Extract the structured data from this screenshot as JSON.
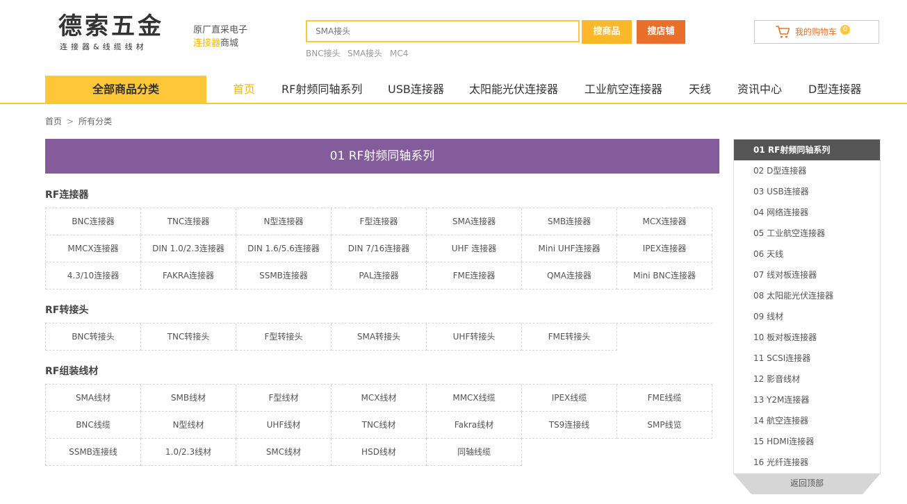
{
  "logo": {
    "main": "德索五金",
    "sub": "连接器&线缆线材"
  },
  "slogan": {
    "line1": "原厂直采电子",
    "line2_highlight": "连接器",
    "line2_rest": "商城"
  },
  "search": {
    "placeholder": "SMA接头",
    "goods_btn": "搜商品",
    "shop_btn": "搜店铺",
    "hot": [
      "BNC接头",
      "SMA接头",
      "MC4"
    ]
  },
  "cart": {
    "label": "我的购物车",
    "count": "0",
    "icon": "cart-icon"
  },
  "nav": {
    "all_categories": "全部商品分类",
    "items": [
      "首页",
      "RF射频同轴系列",
      "USB连接器",
      "太阳能光伏连接器",
      "工业航空连接器",
      "天线",
      "资讯中心",
      "D型连接器"
    ]
  },
  "breadcrumb": {
    "home": "首页",
    "sep": ">",
    "current": "所有分类"
  },
  "category_title": "01 RF射频同轴系列",
  "sections": [
    {
      "title": "RF连接器",
      "items": [
        "BNC连接器",
        "TNC连接器",
        "N型连接器",
        "F型连接器",
        "SMA连接器",
        "SMB连接器",
        "MCX连接器",
        "MMCX连接器",
        "DIN 1.0/2.3连接器",
        "DIN 1.6/5.6连接器",
        "DIN 7/16连接器",
        "UHF 连接器",
        "Mini UHF连接器",
        "IPEX连接器",
        "4.3/10连接器",
        "FAKRA连接器",
        "SSMB连接器",
        "PAL连接器",
        "FME连接器",
        "QMA连接器",
        "Mini BNC连接器"
      ]
    },
    {
      "title": "RF转接头",
      "items": [
        "BNC转接头",
        "TNC转接头",
        "F型转接头",
        "SMA转接头",
        "UHF转接头",
        "FME转接头"
      ]
    },
    {
      "title": "RF组装线材",
      "items": [
        "SMA线材",
        "SMB线材",
        "F型线材",
        "MCX线材",
        "MMCX线缆",
        "IPEX线缆",
        "FME线缆",
        "BNC线缆",
        "N型线材",
        "UHF线材",
        "TNC线材",
        "Fakra线材",
        "TS9连接线",
        "SMP线览",
        "SSMB连接线",
        "1.0/2.3线材",
        "SMC线材",
        "HSD线材",
        "同轴线缆"
      ]
    }
  ],
  "sidebar": [
    "01 RF射频同轴系列",
    "02 D型连接器",
    "03 USB连接器",
    "04 网络连接器",
    "05 工业航空连接器",
    "06 天线",
    "07 线对板连接器",
    "08 太阳能光伏连接器",
    "09 线材",
    "10 板对板连接器",
    "11 SCSI连接器",
    "12 影音线材",
    "13 Y2M连接器",
    "14 航空连接器",
    "15 HDMI连接器",
    "16 光纤连接器"
  ],
  "back_to_top": "返回顶部",
  "colors": {
    "yellow": "#fec738",
    "orange": "#e8702a",
    "purple": "#845c9b",
    "active_nav": "#f5b800"
  }
}
